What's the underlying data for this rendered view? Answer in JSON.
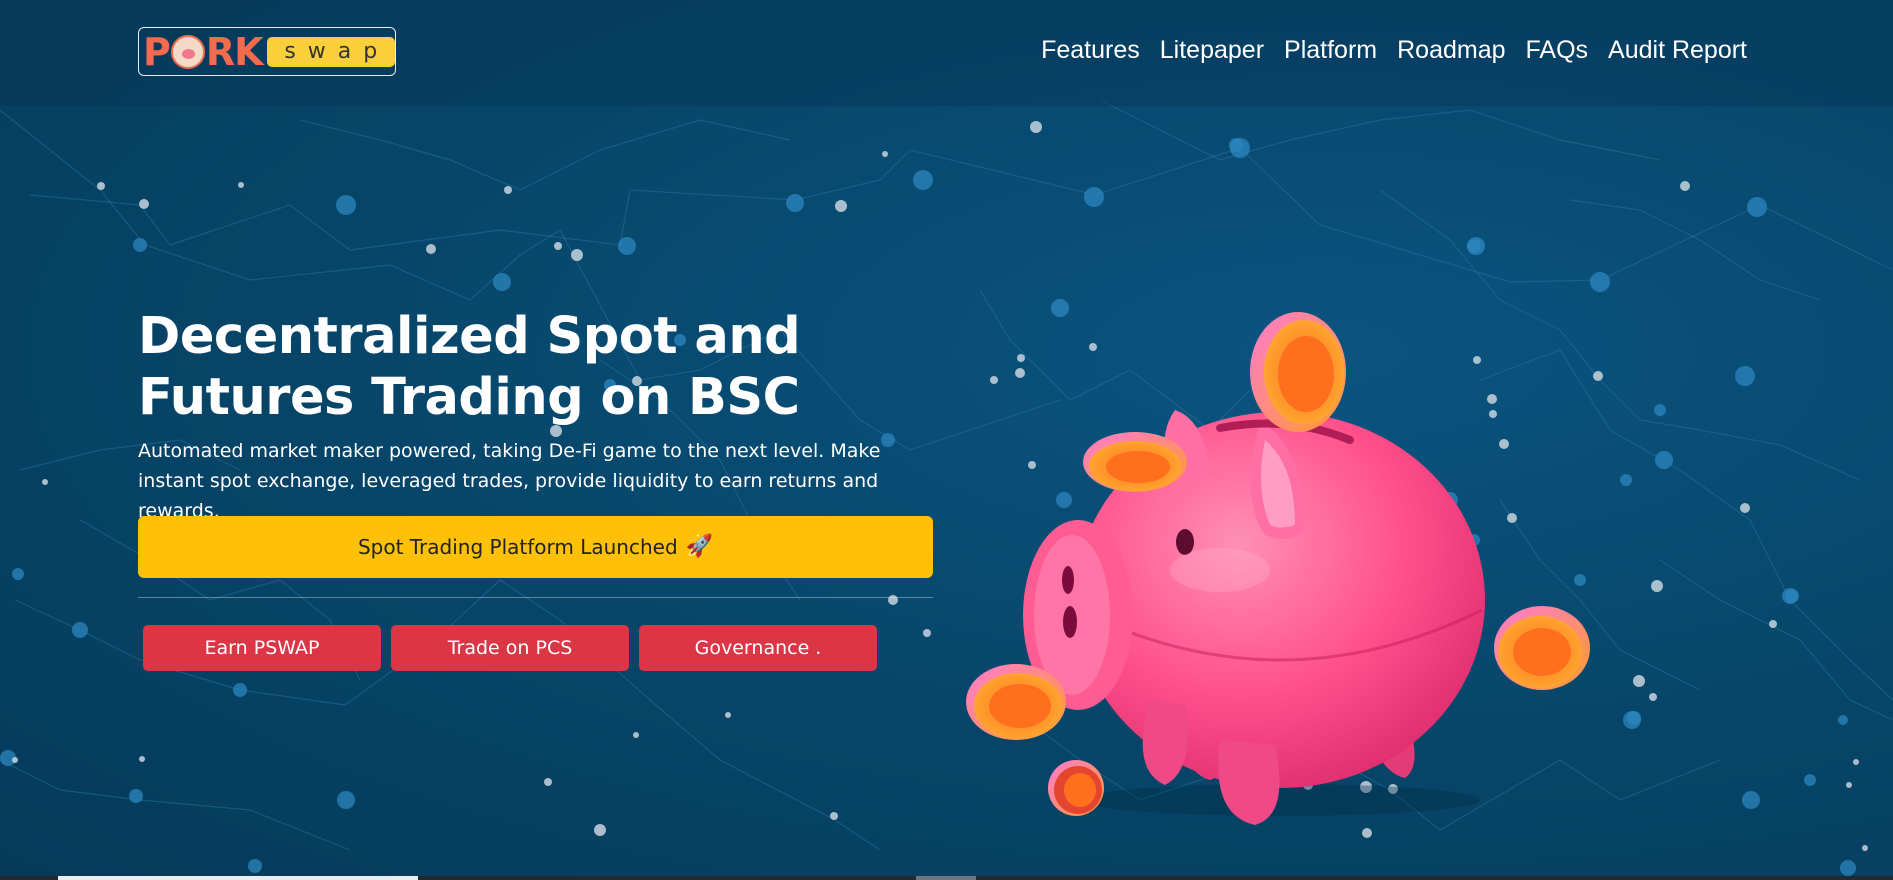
{
  "logo": {
    "pork_prefix": "P",
    "pork_suffix": "RK",
    "swap": "swap"
  },
  "nav": {
    "items": [
      {
        "label": "Features"
      },
      {
        "label": "Litepaper"
      },
      {
        "label": "Platform"
      },
      {
        "label": "Roadmap"
      },
      {
        "label": "FAQs"
      },
      {
        "label": "Audit Report"
      }
    ]
  },
  "hero": {
    "title": "Decentralized Spot and Futures Trading on BSC",
    "subtitle": "Automated market maker powered, taking De-Fi game to the next level. Make instant spot exchange, leveraged trades, provide liquidity to earn returns and rewards.",
    "launch_label": "Spot Trading Platform Launched",
    "launch_icon": "🚀",
    "buttons": [
      {
        "label": "Earn PSWAP"
      },
      {
        "label": "Trade on PCS"
      },
      {
        "label": "Governance ."
      }
    ],
    "illustration": "piggy-bank-with-coins-icon"
  },
  "colors": {
    "background": "#08496e",
    "accent_yellow": "#ffc107",
    "accent_red": "#dc3545",
    "pig_pink": "#ff4f8b",
    "coin_orange": "#ff8a1f",
    "logo_orange": "#f26b4e",
    "logo_yellow": "#f9d03a"
  }
}
